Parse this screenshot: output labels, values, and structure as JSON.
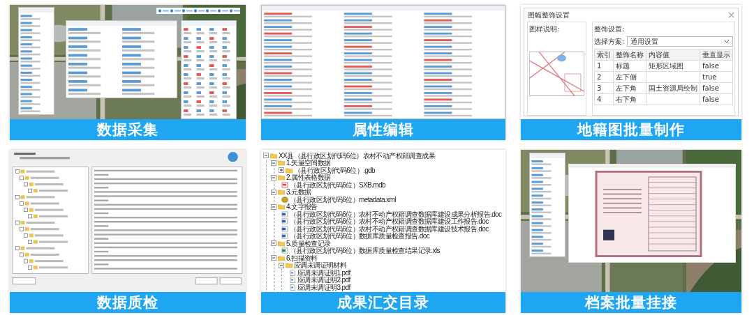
{
  "panels": [
    {
      "kind": "map_collection",
      "caption": "数据采集"
    },
    {
      "kind": "attribute_form",
      "caption": "属性编辑"
    },
    {
      "kind": "map_sheet",
      "caption": "地籍图批量制作",
      "dialog": {
        "title": "图幅整饰设置",
        "preview_label": "图样说明:",
        "settings_label": "整饰设置:",
        "scheme_label": "选择方案:",
        "scheme_value": "通用设置",
        "columns": [
          "索引",
          "整饰名称",
          "内容值",
          "垂直显示"
        ],
        "rows": [
          [
            "1",
            "标题",
            "矩形区域图",
            "false"
          ],
          [
            "2",
            "左下侧",
            "",
            "true"
          ],
          [
            "3",
            "左下角",
            "国土资源局绘制",
            "false"
          ],
          [
            "4",
            "右下角",
            "",
            "false"
          ]
        ]
      }
    },
    {
      "kind": "quality_check",
      "caption": "数据质检"
    },
    {
      "kind": "directory_tree",
      "caption": "成果汇交目录",
      "tree": [
        {
          "kind": "folder",
          "label": "XX县（县行政区划代码6位）农村不动产权籍调查成果",
          "expanded": true,
          "children": [
            {
              "kind": "folder",
              "label": "1.矢量空间数据",
              "expanded": true,
              "children": [
                {
                  "kind": "folder",
                  "label": "（县行政区划代码6位）.gdb",
                  "expanded": false
                }
              ]
            },
            {
              "kind": "folder",
              "label": "2.属性表格数据",
              "expanded": true,
              "children": [
                {
                  "kind": "database",
                  "label": "（县行政区划代码6位）SXB.mdb"
                }
              ]
            },
            {
              "kind": "folder",
              "label": "3.元数据",
              "expanded": true,
              "children": [
                {
                  "kind": "xml",
                  "label": "（县行政区划代码6位）metadata.xml"
                }
              ]
            },
            {
              "kind": "folder",
              "label": "4.文字报告",
              "expanded": true,
              "children": [
                {
                  "kind": "word",
                  "label": "（县行政区划代码6位）农村不动产权籍调查数据库建设成果分析报告.doc"
                },
                {
                  "kind": "word",
                  "label": "（县行政区划代码6位）农村不动产权籍调查数据库建设工作报告.doc"
                },
                {
                  "kind": "word",
                  "label": "（县行政区划代码6位）农村不动产权籍调查数据库建设技术报告.doc"
                },
                {
                  "kind": "word",
                  "label": "（县行政区划代码6位）数据库质量检查报告.doc"
                }
              ]
            },
            {
              "kind": "folder",
              "label": "5.质量检查记录",
              "expanded": true,
              "children": [
                {
                  "kind": "excel",
                  "label": "（县行政区划代码6位）数据库质量检查结果记录.xls"
                }
              ]
            },
            {
              "kind": "folder",
              "label": "6.扫描资料",
              "expanded": true,
              "children": [
                {
                  "kind": "folder",
                  "label": "应调未调证明材料",
                  "expanded": true,
                  "children": [
                    {
                      "kind": "pdf",
                      "label": "应调未调证明1.pdf"
                    },
                    {
                      "kind": "pdf",
                      "label": "应调未调证明2.pdf"
                    },
                    {
                      "kind": "pdf",
                      "label": "应调未调证明3.pdf"
                    }
                  ]
                }
              ]
            }
          ]
        }
      ]
    },
    {
      "kind": "archive_link",
      "caption": "档案批量挂接"
    }
  ]
}
